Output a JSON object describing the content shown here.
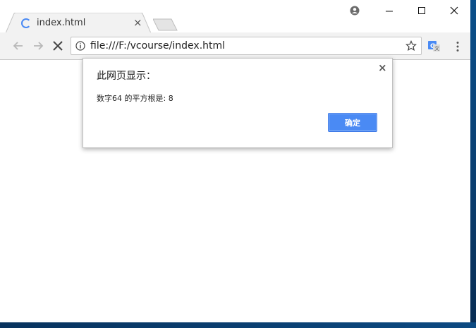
{
  "window": {
    "tab_title": "index.html",
    "tab_close_glyph": "×",
    "controls": {
      "minimize": "–",
      "maximize": "☐",
      "close": "✕"
    }
  },
  "toolbar": {
    "url": "file:///F:/vcourse/index.html",
    "icons": [
      "back-arrow-icon",
      "forward-arrow-icon",
      "stop-icon",
      "info-icon",
      "star-icon",
      "translate-icon",
      "menu-icon",
      "profile-icon"
    ]
  },
  "dialog": {
    "title": "此网页显示：",
    "message": "数字64 的平方根是: 8",
    "ok_label": "确定",
    "close_glyph": "×"
  },
  "colors": {
    "accent": "#4a8af4",
    "desktop": "#0a4f8a"
  }
}
